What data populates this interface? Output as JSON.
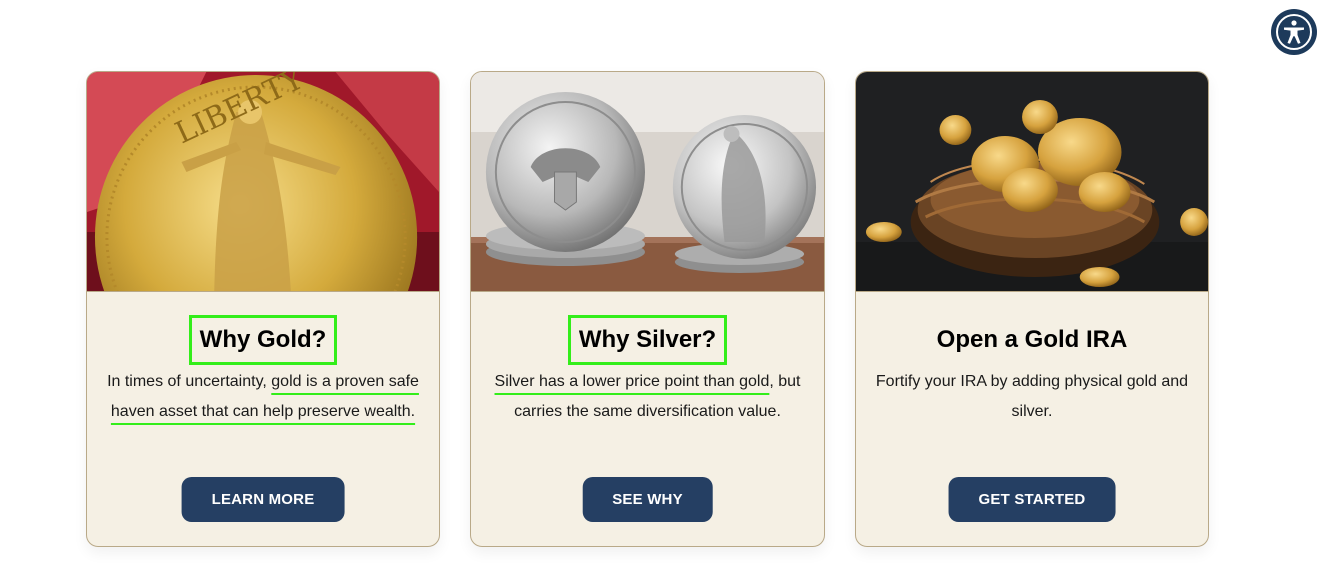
{
  "accessibility": {
    "icon": "accessibility-person-icon",
    "color": "#1d3a5b"
  },
  "cards": [
    {
      "image": "gold-liberty-coin",
      "title": "Why Gold?",
      "desc_pre": "In times of uncertainty, ",
      "desc_mark": "gold is a proven safe haven asset that can help preserve wealth.",
      "button": "LEARN MORE"
    },
    {
      "image": "silver-eagle-coins",
      "title": "Why Silver?",
      "desc_mark": "Silver has a lower price point than gold",
      "desc_post": ", but carries the same diversification value.",
      "button": "SEE WHY"
    },
    {
      "image": "gold-coins-nest",
      "title": "Open a Gold IRA",
      "desc": "Fortify your IRA by adding physical gold and silver.",
      "button": "GET STARTED"
    }
  ],
  "colors": {
    "card_bg": "#f5f0e4",
    "card_border": "#b9a988",
    "button_bg": "#253f63",
    "highlight": "#33ee1a"
  }
}
